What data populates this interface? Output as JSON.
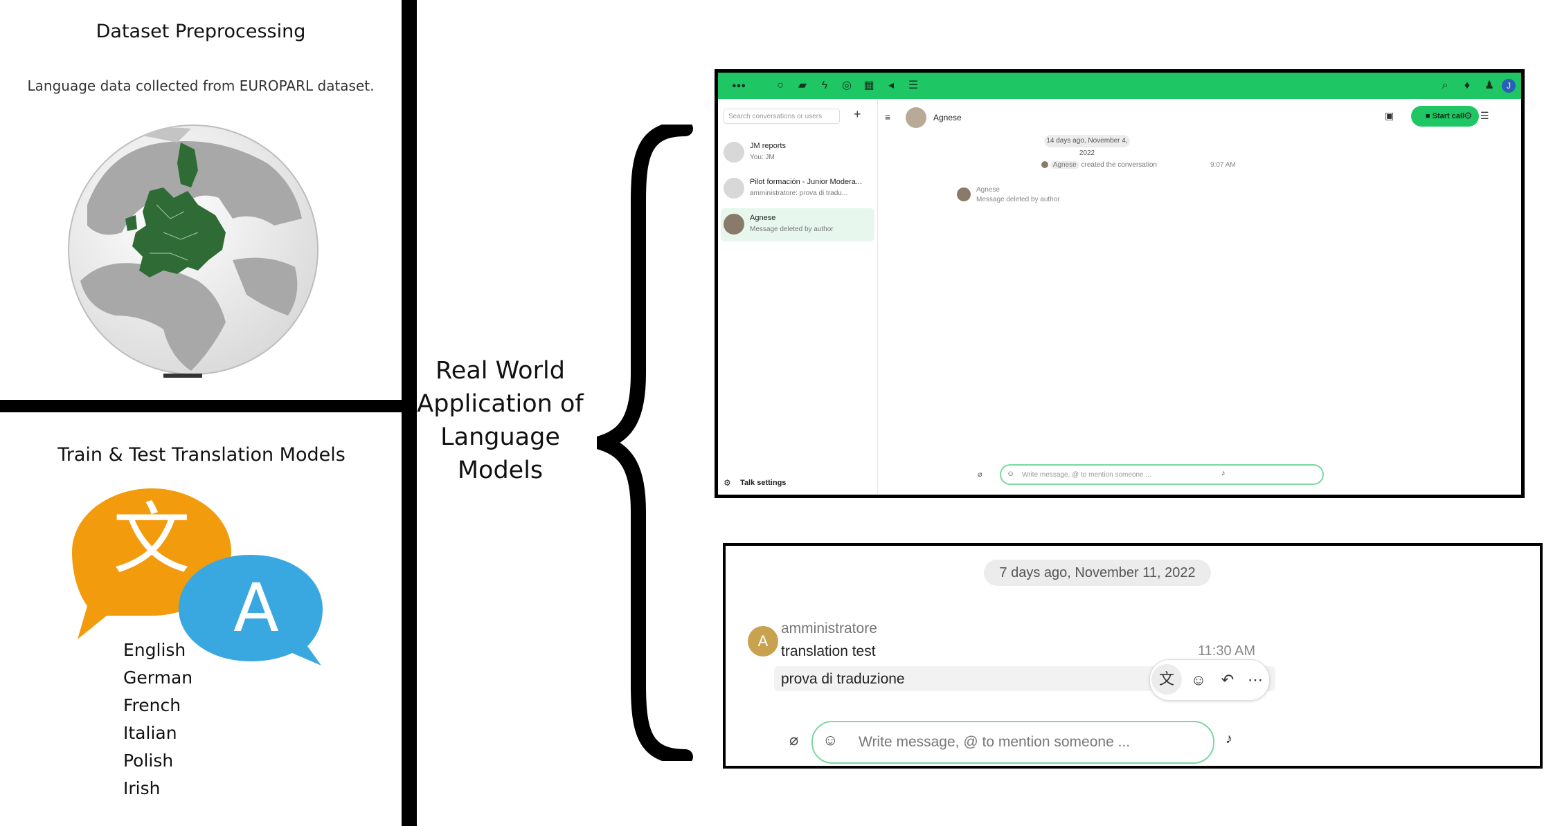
{
  "left_panel": {
    "top": {
      "title": "Dataset Preprocessing",
      "caption": "Language data collected from EUROPARL dataset."
    },
    "bottom": {
      "title": "Train & Test Translation Models",
      "icon_char_source": "文",
      "icon_char_target": "A",
      "languages": [
        "English",
        "German",
        "French",
        "Italian",
        "Polish",
        "Irish"
      ]
    }
  },
  "center": {
    "lines": [
      "Real World",
      "Application of",
      "Language",
      "Models"
    ]
  },
  "screenshot_top": {
    "search_placeholder": "Search conversations or users",
    "conversations": [
      {
        "name": "JM reports",
        "sub": "You: JM"
      },
      {
        "name": "Pilot formación - Junior Modera...",
        "sub": "amministratore: prova di tradu..."
      },
      {
        "name": "Agnese",
        "sub": "Message deleted by author"
      }
    ],
    "header_name": "Agnese",
    "start_call": "Start call",
    "date_pill": "14 days ago, November 4, 2022",
    "system_user": "Agnese",
    "system_text": "created the conversation",
    "system_time": "9:07 AM",
    "message_author": "Agnese",
    "message_text": "Message deleted by author",
    "input_placeholder": "Write message, @ to mention someone ...",
    "settings_label": "Talk settings"
  },
  "screenshot_bottom": {
    "date_pill": "7 days ago, November 11, 2022",
    "avatar_letter": "A",
    "author": "amministratore",
    "message1": "translation test",
    "time": "11:30 AM",
    "message2": "prova di traduzione",
    "input_placeholder": "Write message, @ to mention someone ..."
  },
  "colors": {
    "talk_green": "#1ec764",
    "europe_green": "#2f6b35",
    "bubble_orange": "#f29b0c",
    "bubble_blue": "#3aa8e0"
  }
}
